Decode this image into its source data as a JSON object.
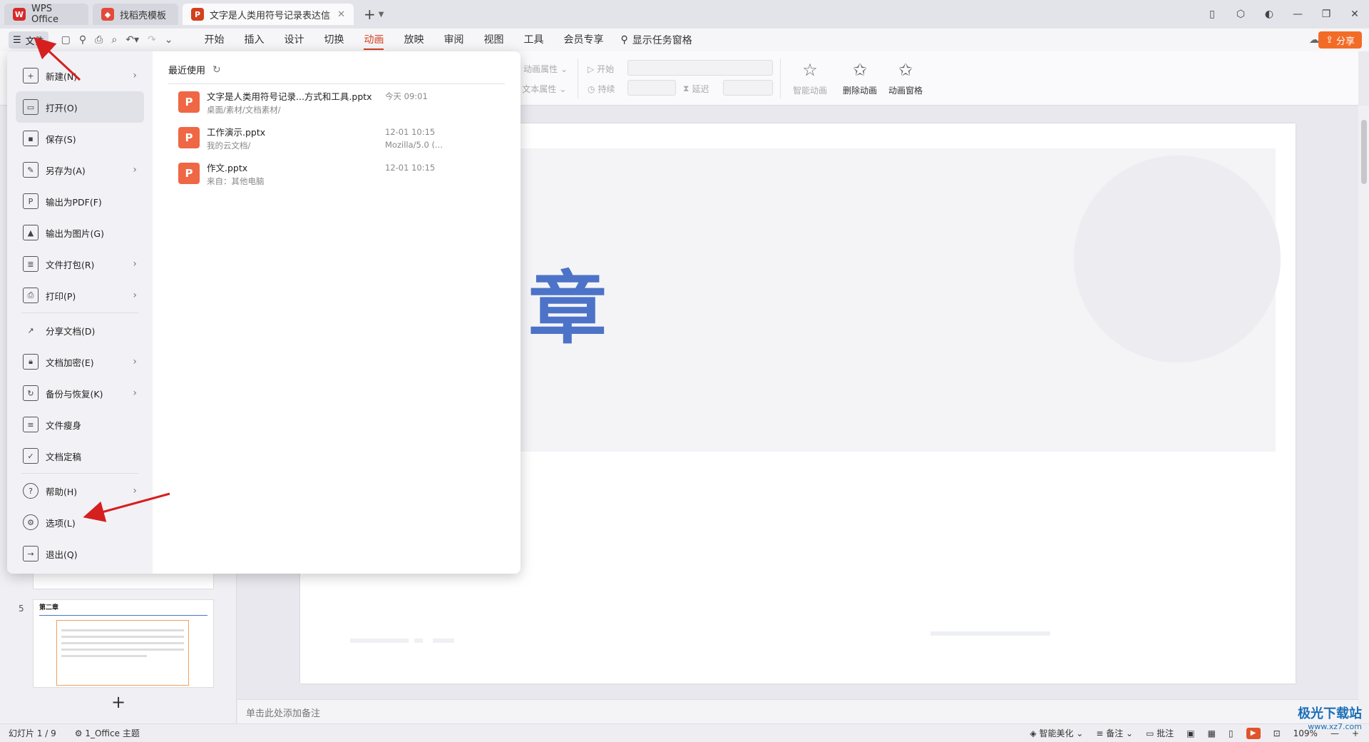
{
  "tabs": [
    {
      "label": "WPS Office",
      "icon": "wps-logo",
      "color": "#d62b2b"
    },
    {
      "label": "找稻壳模板",
      "icon": "docer-logo",
      "color": "#e24a3b"
    },
    {
      "label": "文字是人类用符号记录表达信息以",
      "icon": "ppt-logo",
      "color": "#d2401d"
    }
  ],
  "menubar": {
    "file_label": "文件",
    "tabs": [
      "开始",
      "插入",
      "设计",
      "切换",
      "动画",
      "放映",
      "审阅",
      "视图",
      "工具",
      "会员专享"
    ],
    "active_tab": "动画",
    "find_label": "显示任务窗格",
    "share_label": "分享"
  },
  "ribbon": {
    "anim_props": "动画属性",
    "text_props": "文本属性",
    "start_label": "开始",
    "duration_label": "持续",
    "delay_label": "延迟",
    "smart_anim": "智能动画",
    "delete_anim": "删除动画",
    "anim_pane": "动画窗格"
  },
  "file_menu": {
    "items": [
      {
        "label": "新建(N)",
        "icon": "new-file-icon",
        "arrow": true
      },
      {
        "label": "打开(O)",
        "icon": "open-folder-icon",
        "arrow": false,
        "active": true
      },
      {
        "label": "保存(S)",
        "icon": "save-icon",
        "arrow": false
      },
      {
        "label": "另存为(A)",
        "icon": "save-as-icon",
        "arrow": true
      },
      {
        "label": "输出为PDF(F)",
        "icon": "pdf-icon",
        "arrow": false
      },
      {
        "label": "输出为图片(G)",
        "icon": "image-icon",
        "arrow": false
      },
      {
        "label": "文件打包(R)",
        "icon": "package-icon",
        "arrow": true
      },
      {
        "label": "打印(P)",
        "icon": "print-icon",
        "arrow": true
      },
      {
        "label": "分享文档(D)",
        "icon": "share-icon",
        "arrow": false,
        "sep_before": true
      },
      {
        "label": "文档加密(E)",
        "icon": "encrypt-icon",
        "arrow": true
      },
      {
        "label": "备份与恢复(K)",
        "icon": "backup-icon",
        "arrow": true
      },
      {
        "label": "文件瘦身",
        "icon": "slim-icon",
        "arrow": false
      },
      {
        "label": "文档定稿",
        "icon": "finalize-icon",
        "arrow": false
      },
      {
        "label": "帮助(H)",
        "icon": "help-icon",
        "arrow": true,
        "sep_before": true
      },
      {
        "label": "选项(L)",
        "icon": "options-gear-icon",
        "arrow": false
      },
      {
        "label": "退出(Q)",
        "icon": "exit-icon",
        "arrow": false
      }
    ],
    "recent_title": "最近使用",
    "recent": [
      {
        "name": "文字是人类用符号记录...方式和工具.pptx",
        "path": "桌面/素材/文档素材/",
        "time": "今天  09:01",
        "extra": ""
      },
      {
        "name": "工作演示.pptx",
        "path": "我的云文档/",
        "time": "12-01  10:15",
        "extra": "Mozilla/5.0 (..."
      },
      {
        "name": "作文.pptx",
        "path": "来自：其他电脑",
        "time": "12-01  10:15",
        "extra": ""
      }
    ]
  },
  "slides_panel": {
    "slide5_num": "5",
    "slide5_title": "第二章"
  },
  "slide": {
    "title_char": "章"
  },
  "notes_placeholder": "单击此处添加备注",
  "statusbar": {
    "slide_info": "幻灯片 1 / 9",
    "theme": "1_Office 主题",
    "smart_beautify": "智能美化",
    "notes": "备注",
    "comment": "批注",
    "zoom": "109%"
  },
  "watermark": "极光下载站",
  "watermark_url": "www.xz7.com",
  "colors": {
    "accent": "#d2401d",
    "share": "#f26c28",
    "slide_title": "#4c73c8",
    "annotation": "#d62020"
  }
}
